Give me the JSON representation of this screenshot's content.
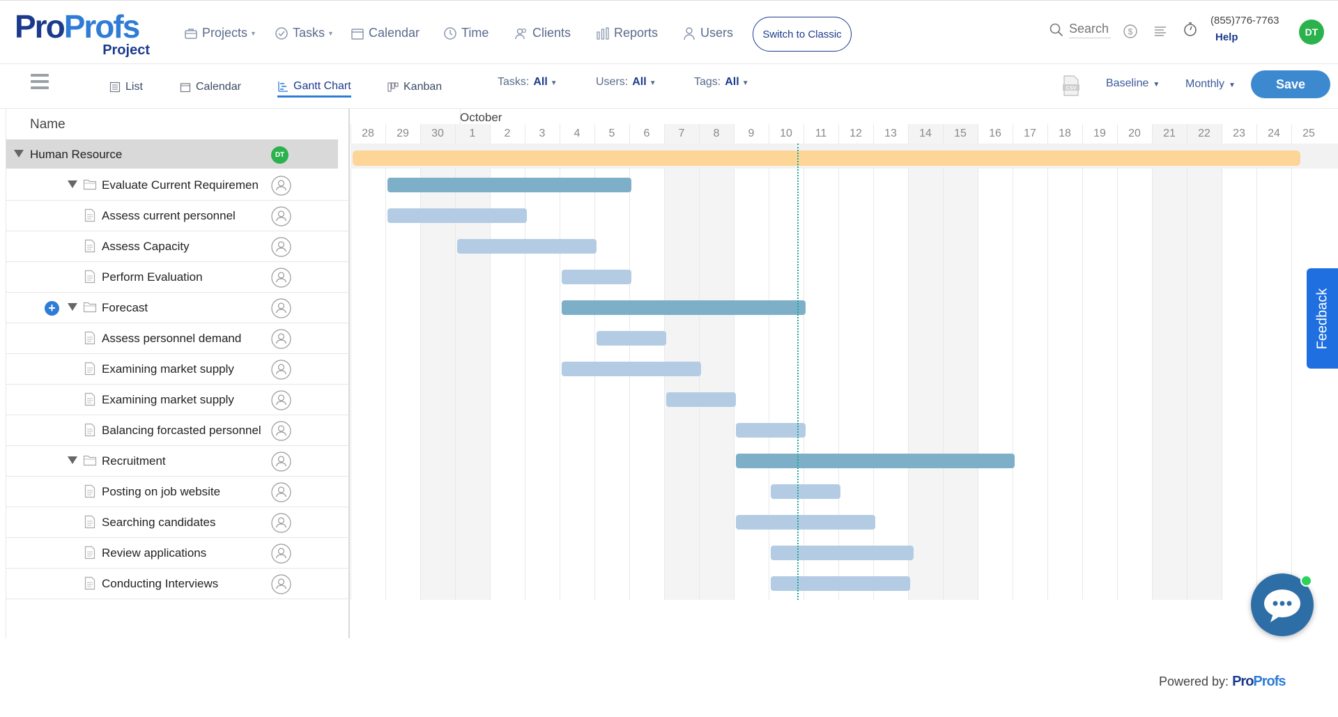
{
  "brand": {
    "logo_pro": "Pro",
    "logo_profs": "Profs",
    "logo_sub": "Project"
  },
  "nav": [
    {
      "label": "Projects",
      "icon": "briefcase-icon",
      "caret": true
    },
    {
      "label": "Tasks",
      "icon": "check-circle-icon",
      "caret": true
    },
    {
      "label": "Calendar",
      "icon": "calendar-icon",
      "caret": false
    },
    {
      "label": "Time",
      "icon": "clock-icon",
      "caret": false
    },
    {
      "label": "Clients",
      "icon": "clients-icon",
      "caret": false
    },
    {
      "label": "Reports",
      "icon": "bar-chart-icon",
      "caret": false
    },
    {
      "label": "Users",
      "icon": "user-icon",
      "caret": false
    }
  ],
  "switch_classic": "Switch to Classic",
  "search": {
    "placeholder": "Search"
  },
  "support": {
    "phone": "(855)776-7763",
    "help": "Help"
  },
  "user": {
    "initials": "DT"
  },
  "toolbar": {
    "views": [
      {
        "label": "List",
        "icon": "list-icon"
      },
      {
        "label": "Calendar",
        "icon": "calendar-icon"
      },
      {
        "label": "Gantt Chart",
        "icon": "gantt-icon",
        "active": true
      },
      {
        "label": "Kanban",
        "icon": "kanban-icon"
      }
    ],
    "filters": [
      {
        "label": "Tasks:",
        "value": "All"
      },
      {
        "label": "Users:",
        "value": "All"
      },
      {
        "label": "Tags:",
        "value": "All"
      }
    ],
    "baseline": "Baseline",
    "period": "Monthly",
    "save": "Save"
  },
  "grid": {
    "name_header": "Name",
    "rows": [
      {
        "label": "Human Resource",
        "kind": "project"
      },
      {
        "label": "Evaluate Current Requiremen",
        "kind": "group"
      },
      {
        "label": "Assess current personnel",
        "kind": "task"
      },
      {
        "label": "Assess Capacity",
        "kind": "task"
      },
      {
        "label": "Perform Evaluation",
        "kind": "task"
      },
      {
        "label": "Forecast",
        "kind": "group",
        "plus": true
      },
      {
        "label": "Assess personnel demand",
        "kind": "task"
      },
      {
        "label": "Examining market supply",
        "kind": "task"
      },
      {
        "label": "Examining market supply",
        "kind": "task"
      },
      {
        "label": "Balancing forcasted personnel",
        "kind": "task"
      },
      {
        "label": "Recruitment",
        "kind": "group"
      },
      {
        "label": "Posting on job website",
        "kind": "task"
      },
      {
        "label": "Searching candidates",
        "kind": "task"
      },
      {
        "label": "Review applications",
        "kind": "task"
      },
      {
        "label": "Conducting Interviews",
        "kind": "task"
      }
    ]
  },
  "gantt": {
    "month": "October",
    "days": [
      "28",
      "29",
      "30",
      "1",
      "2",
      "3",
      "4",
      "5",
      "6",
      "7",
      "8",
      "9",
      "10",
      "11",
      "12",
      "13",
      "14",
      "15",
      "16",
      "17",
      "18",
      "19",
      "20",
      "21",
      "22",
      "23",
      "24",
      "25"
    ],
    "weekend_day_indices": [
      2,
      3,
      9,
      10,
      16,
      17,
      23,
      24
    ],
    "today_day": "10",
    "bars": [
      {
        "start_day_index": 0,
        "duration_days": 27.2,
        "kind": "proj"
      },
      {
        "start_day_index": 1,
        "duration_days": 7,
        "kind": "grp"
      },
      {
        "start_day_index": 1,
        "duration_days": 4,
        "kind": "task"
      },
      {
        "start_day_index": 3,
        "duration_days": 4,
        "kind": "task"
      },
      {
        "start_day_index": 6,
        "duration_days": 2,
        "kind": "task"
      },
      {
        "start_day_index": 6,
        "duration_days": 7,
        "kind": "grp"
      },
      {
        "start_day_index": 7,
        "duration_days": 2,
        "kind": "task"
      },
      {
        "start_day_index": 6,
        "duration_days": 4,
        "kind": "task"
      },
      {
        "start_day_index": 9,
        "duration_days": 2,
        "kind": "task"
      },
      {
        "start_day_index": 11,
        "duration_days": 2,
        "kind": "task"
      },
      {
        "start_day_index": 11,
        "duration_days": 8,
        "kind": "grp"
      },
      {
        "start_day_index": 12,
        "duration_days": 2,
        "kind": "task"
      },
      {
        "start_day_index": 11,
        "duration_days": 4,
        "kind": "task"
      },
      {
        "start_day_index": 12,
        "duration_days": 4.1,
        "kind": "task"
      },
      {
        "start_day_index": 12,
        "duration_days": 4,
        "kind": "task"
      }
    ]
  },
  "feedback": "Feedback",
  "powered_by": "Powered by:"
}
